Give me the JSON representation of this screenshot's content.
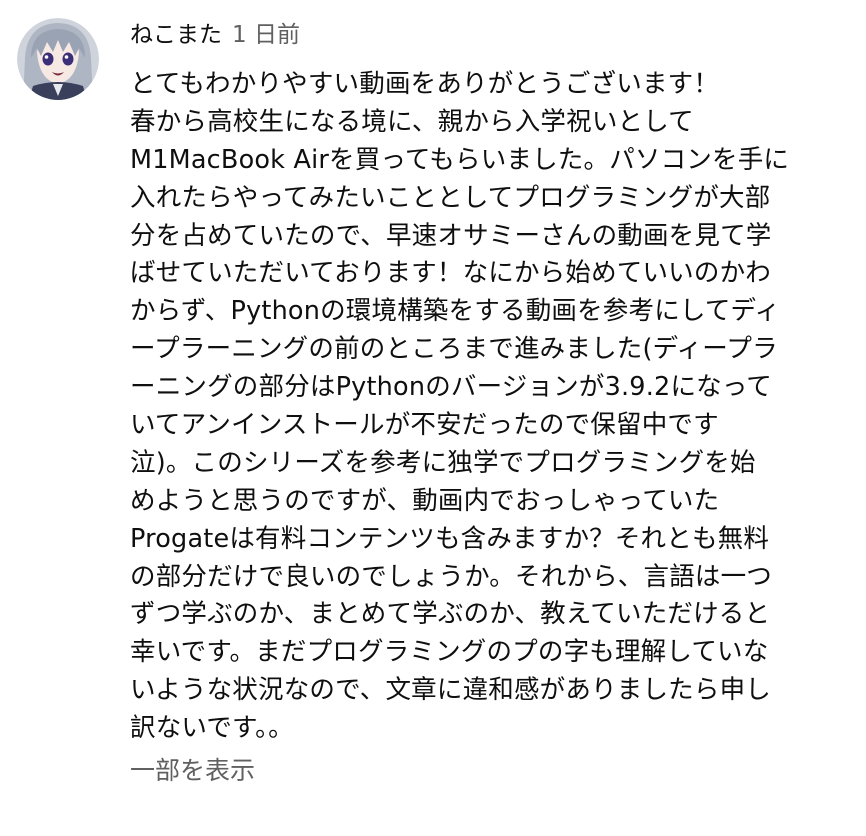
{
  "comment": {
    "author": "ねこまた",
    "time": "1 日前",
    "lines": [
      "とてもわかりやすい動画をありがとうございます！",
      "春から高校生になる境に、親から入学祝いとして",
      "M1MacBook Airを買ってもらいました。パソコンを手に",
      "入れたらやってみたいこととしてプログラミングが大部",
      "分を占めていたので、早速オサミーさんの動画を見て学",
      "ばせていただいております！なにから始めていいのかわ",
      "からず、Pythonの環境構築をする動画を参考にしてディ",
      "ープラーニングの前のところまで進みました(ディープラ",
      "ーニングの部分はPythonのバージョンが3.9.2になって",
      "いてアンインストールが不安だったので保留中です",
      "泣)。このシリーズを参考に独学でプログラミングを始",
      "めようと思うのですが、動画内でおっしゃっていた",
      "Progateは有料コンテンツも含みますか？それとも無料",
      "の部分だけで良いのでしょうか。それから、言語は一つ",
      "ずつ学ぶのか、まとめて学ぶのか、教えていただけると",
      "幸いです。まだプログラミングのプの字も理解していな",
      "いような状況なので、文章に違和感がありましたら申し",
      "訳ないです。。"
    ],
    "show_more_label": "一部を表示",
    "avatar_icon": "anime-character-avatar"
  },
  "colors": {
    "text_primary": "#0f0f0f",
    "text_secondary": "#606060",
    "background": "#ffffff"
  }
}
